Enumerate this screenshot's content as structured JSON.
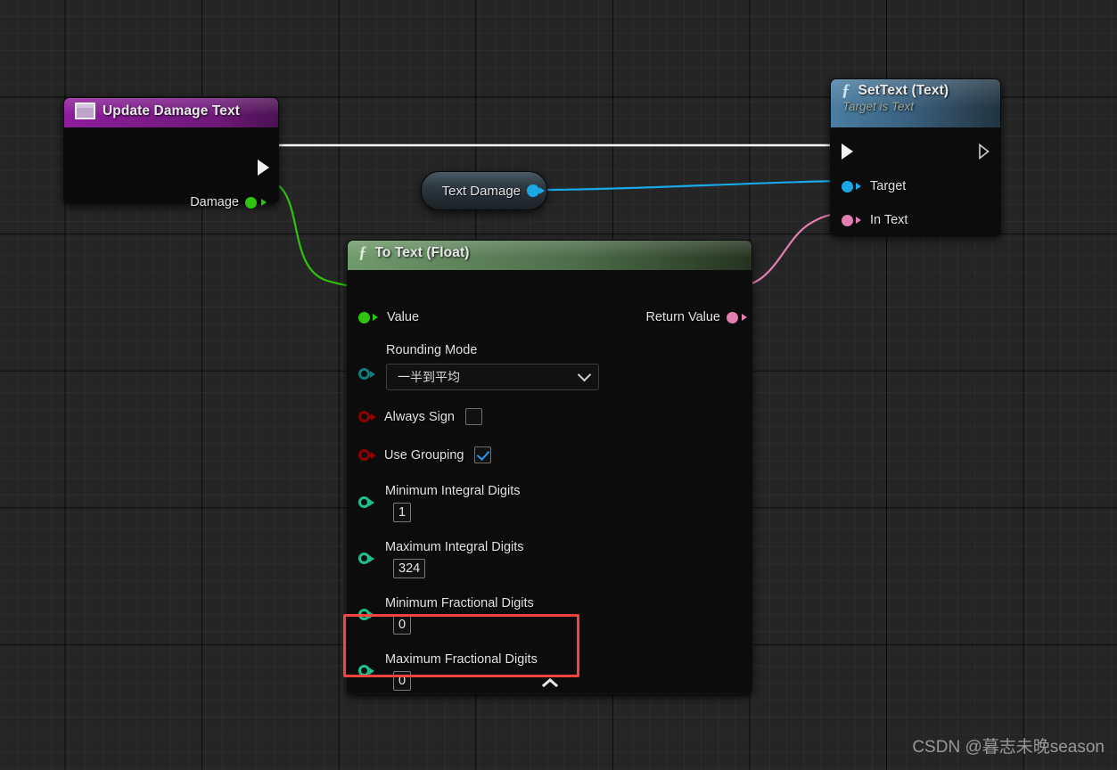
{
  "app": {
    "context": "Unreal Engine Blueprint Event Graph",
    "watermark": "CSDN @暮志未晚season"
  },
  "colors": {
    "exec_wire": "#ffffff",
    "float_wire": "#2fc20f",
    "object_wire": "#19a8e8",
    "text_wire": "#e17fb0",
    "event_header": "#9b21a8",
    "function_header_blue": "#3f6f92",
    "function_header_green": "#5d8a5a",
    "variable_node": "#3a4650",
    "highlight": "#f4443c",
    "float_pin": "#2fc20f",
    "text_pin": "#e17fb0",
    "object_pin": "#19a8e8",
    "byte_pin": "#0f7b7b",
    "bool_pin": "#8c0000",
    "int_pin": "#1fbf8f"
  },
  "nodes": {
    "event_update_damage_text": {
      "title": "Update Damage Text",
      "icon": "event-node-icon",
      "outputs": [
        {
          "name": "exec",
          "label": "",
          "type": "exec"
        },
        {
          "name": "damage",
          "label": "Damage",
          "type": "float"
        }
      ]
    },
    "variable_text_damage": {
      "title": "Text Damage",
      "output": {
        "label": "",
        "type": "object"
      }
    },
    "to_text_float": {
      "title": "To Text (Float)",
      "icon": "function-f-icon",
      "inputs": {
        "value": {
          "label": "Value",
          "type": "float"
        },
        "rounding_mode": {
          "label": "Rounding Mode",
          "type": "byte",
          "selected_option": "一半到平均"
        },
        "always_sign": {
          "label": "Always Sign",
          "type": "bool",
          "checked": false
        },
        "use_grouping": {
          "label": "Use Grouping",
          "type": "bool",
          "checked": true
        },
        "minimum_integral_digits": {
          "label": "Minimum Integral Digits",
          "type": "int",
          "value": "1"
        },
        "maximum_integral_digits": {
          "label": "Maximum Integral Digits",
          "type": "int",
          "value": "324"
        },
        "minimum_fractional_digits": {
          "label": "Minimum Fractional Digits",
          "type": "int",
          "value": "0"
        },
        "maximum_fractional_digits": {
          "label": "Maximum Fractional Digits",
          "type": "int",
          "value": "0",
          "highlighted": true
        }
      },
      "outputs": {
        "return_value": {
          "label": "Return Value",
          "type": "text"
        }
      }
    },
    "set_text": {
      "title": "SetText (Text)",
      "subtitle": "Target is Text",
      "icon": "function-f-icon",
      "inputs": [
        {
          "name": "exec-in",
          "label": "",
          "type": "exec"
        },
        {
          "name": "target",
          "label": "Target",
          "type": "object"
        },
        {
          "name": "in-text",
          "label": "In Text",
          "type": "text"
        }
      ],
      "outputs": [
        {
          "name": "exec-out",
          "label": "",
          "type": "exec"
        }
      ]
    }
  }
}
